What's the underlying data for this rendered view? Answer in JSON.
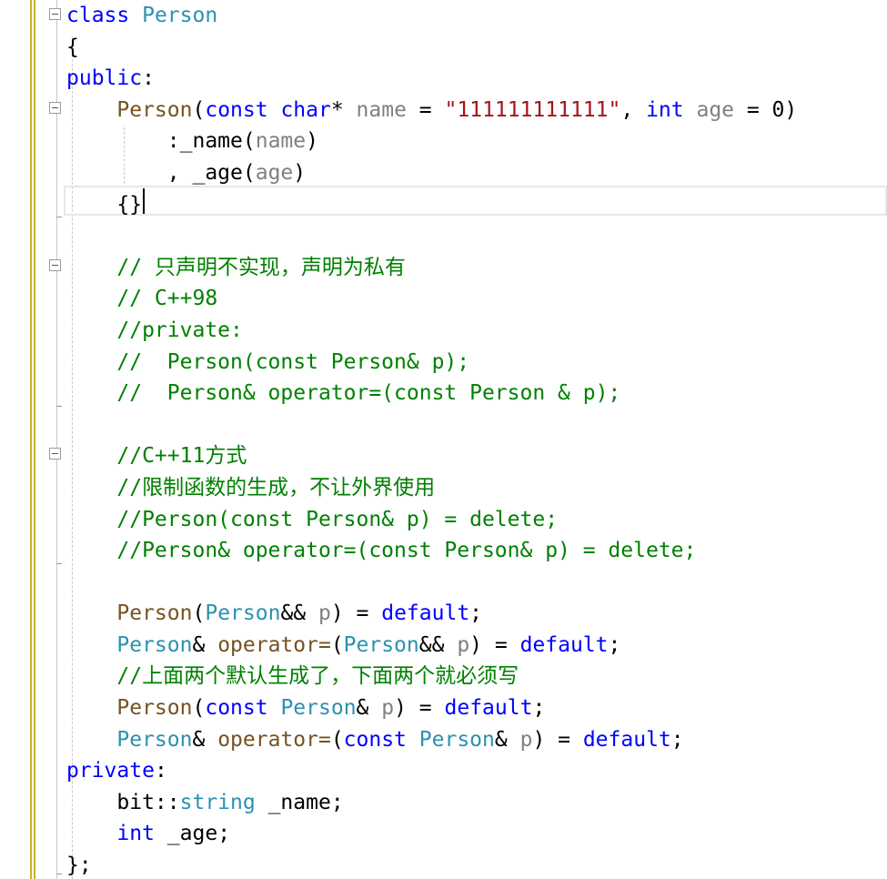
{
  "colors": {
    "keyword": "#0000ff",
    "type": "#2b91af",
    "parameter": "#808080",
    "string": "#a31515",
    "comment": "#008000",
    "function": "#74531f",
    "plain": "#000000",
    "change_bar": "#c8b22a"
  },
  "icons": {
    "fold": "minus-box-icon"
  },
  "code_lines": [
    [
      {
        "k": "keyword",
        "t": "class"
      },
      {
        "k": "default",
        "t": " "
      },
      {
        "k": "type",
        "t": "Person"
      }
    ],
    [
      {
        "k": "default",
        "t": "{"
      }
    ],
    [
      {
        "k": "keyword",
        "t": "public"
      },
      {
        "k": "default",
        "t": ":"
      }
    ],
    [
      {
        "k": "default",
        "t": "    "
      },
      {
        "k": "func",
        "t": "Person"
      },
      {
        "k": "default",
        "t": "("
      },
      {
        "k": "keyword",
        "t": "const"
      },
      {
        "k": "default",
        "t": " "
      },
      {
        "k": "keyword",
        "t": "char"
      },
      {
        "k": "default",
        "t": "* "
      },
      {
        "k": "param",
        "t": "name"
      },
      {
        "k": "default",
        "t": " = "
      },
      {
        "k": "string",
        "t": "\"111111111111\""
      },
      {
        "k": "default",
        "t": ", "
      },
      {
        "k": "keyword",
        "t": "int"
      },
      {
        "k": "default",
        "t": " "
      },
      {
        "k": "param",
        "t": "age"
      },
      {
        "k": "default",
        "t": " = 0)"
      }
    ],
    [
      {
        "k": "default",
        "t": "        :"
      },
      {
        "k": "member",
        "t": "_name"
      },
      {
        "k": "default",
        "t": "("
      },
      {
        "k": "param",
        "t": "name"
      },
      {
        "k": "default",
        "t": ")"
      }
    ],
    [
      {
        "k": "default",
        "t": "        , "
      },
      {
        "k": "member",
        "t": "_age"
      },
      {
        "k": "default",
        "t": "("
      },
      {
        "k": "param",
        "t": "age"
      },
      {
        "k": "default",
        "t": ")"
      }
    ],
    [
      {
        "k": "default",
        "t": "    {}"
      }
    ],
    [
      {
        "k": "default",
        "t": ""
      }
    ],
    [
      {
        "k": "default",
        "t": "    "
      },
      {
        "k": "comment",
        "t": "// 只声明不实现，声明为私有"
      }
    ],
    [
      {
        "k": "default",
        "t": "    "
      },
      {
        "k": "comment",
        "t": "// C++98"
      }
    ],
    [
      {
        "k": "default",
        "t": "    "
      },
      {
        "k": "comment",
        "t": "//private:"
      }
    ],
    [
      {
        "k": "default",
        "t": "    "
      },
      {
        "k": "comment",
        "t": "//  Person(const Person& p);"
      }
    ],
    [
      {
        "k": "default",
        "t": "    "
      },
      {
        "k": "comment",
        "t": "//  Person& operator=(const Person & p);"
      }
    ],
    [
      {
        "k": "default",
        "t": ""
      }
    ],
    [
      {
        "k": "default",
        "t": "    "
      },
      {
        "k": "comment",
        "t": "//C++11方式"
      }
    ],
    [
      {
        "k": "default",
        "t": "    "
      },
      {
        "k": "comment",
        "t": "//限制函数的生成，不让外界使用"
      }
    ],
    [
      {
        "k": "default",
        "t": "    "
      },
      {
        "k": "comment",
        "t": "//Person(const Person& p) = delete;"
      }
    ],
    [
      {
        "k": "default",
        "t": "    "
      },
      {
        "k": "comment",
        "t": "//Person& operator=(const Person& p) = delete;"
      }
    ],
    [
      {
        "k": "default",
        "t": ""
      }
    ],
    [
      {
        "k": "default",
        "t": "    "
      },
      {
        "k": "func",
        "t": "Person"
      },
      {
        "k": "default",
        "t": "("
      },
      {
        "k": "type",
        "t": "Person"
      },
      {
        "k": "default",
        "t": "&& "
      },
      {
        "k": "param",
        "t": "p"
      },
      {
        "k": "default",
        "t": ") = "
      },
      {
        "k": "keyword",
        "t": "default"
      },
      {
        "k": "default",
        "t": ";"
      }
    ],
    [
      {
        "k": "default",
        "t": "    "
      },
      {
        "k": "type",
        "t": "Person"
      },
      {
        "k": "default",
        "t": "& "
      },
      {
        "k": "func",
        "t": "operator="
      },
      {
        "k": "default",
        "t": "("
      },
      {
        "k": "type",
        "t": "Person"
      },
      {
        "k": "default",
        "t": "&& "
      },
      {
        "k": "param",
        "t": "p"
      },
      {
        "k": "default",
        "t": ") = "
      },
      {
        "k": "keyword",
        "t": "default"
      },
      {
        "k": "default",
        "t": ";"
      }
    ],
    [
      {
        "k": "default",
        "t": "    "
      },
      {
        "k": "comment",
        "t": "//上面两个默认生成了，下面两个就必须写"
      }
    ],
    [
      {
        "k": "default",
        "t": "    "
      },
      {
        "k": "func",
        "t": "Person"
      },
      {
        "k": "default",
        "t": "("
      },
      {
        "k": "keyword",
        "t": "const"
      },
      {
        "k": "default",
        "t": " "
      },
      {
        "k": "type",
        "t": "Person"
      },
      {
        "k": "default",
        "t": "& "
      },
      {
        "k": "param",
        "t": "p"
      },
      {
        "k": "default",
        "t": ") = "
      },
      {
        "k": "keyword",
        "t": "default"
      },
      {
        "k": "default",
        "t": ";"
      }
    ],
    [
      {
        "k": "default",
        "t": "    "
      },
      {
        "k": "type",
        "t": "Person"
      },
      {
        "k": "default",
        "t": "& "
      },
      {
        "k": "func",
        "t": "operator="
      },
      {
        "k": "default",
        "t": "("
      },
      {
        "k": "keyword",
        "t": "const"
      },
      {
        "k": "default",
        "t": " "
      },
      {
        "k": "type",
        "t": "Person"
      },
      {
        "k": "default",
        "t": "& "
      },
      {
        "k": "param",
        "t": "p"
      },
      {
        "k": "default",
        "t": ") = "
      },
      {
        "k": "keyword",
        "t": "default"
      },
      {
        "k": "default",
        "t": ";"
      }
    ],
    [
      {
        "k": "keyword",
        "t": "private"
      },
      {
        "k": "default",
        "t": ":"
      }
    ],
    [
      {
        "k": "default",
        "t": "    bit::"
      },
      {
        "k": "type",
        "t": "string"
      },
      {
        "k": "default",
        "t": " "
      },
      {
        "k": "member",
        "t": "_name"
      },
      {
        "k": "default",
        "t": ";"
      }
    ],
    [
      {
        "k": "default",
        "t": "    "
      },
      {
        "k": "keyword",
        "t": "int"
      },
      {
        "k": "default",
        "t": " "
      },
      {
        "k": "member",
        "t": "_age"
      },
      {
        "k": "default",
        "t": ";"
      }
    ],
    [
      {
        "k": "default",
        "t": "};"
      }
    ]
  ]
}
